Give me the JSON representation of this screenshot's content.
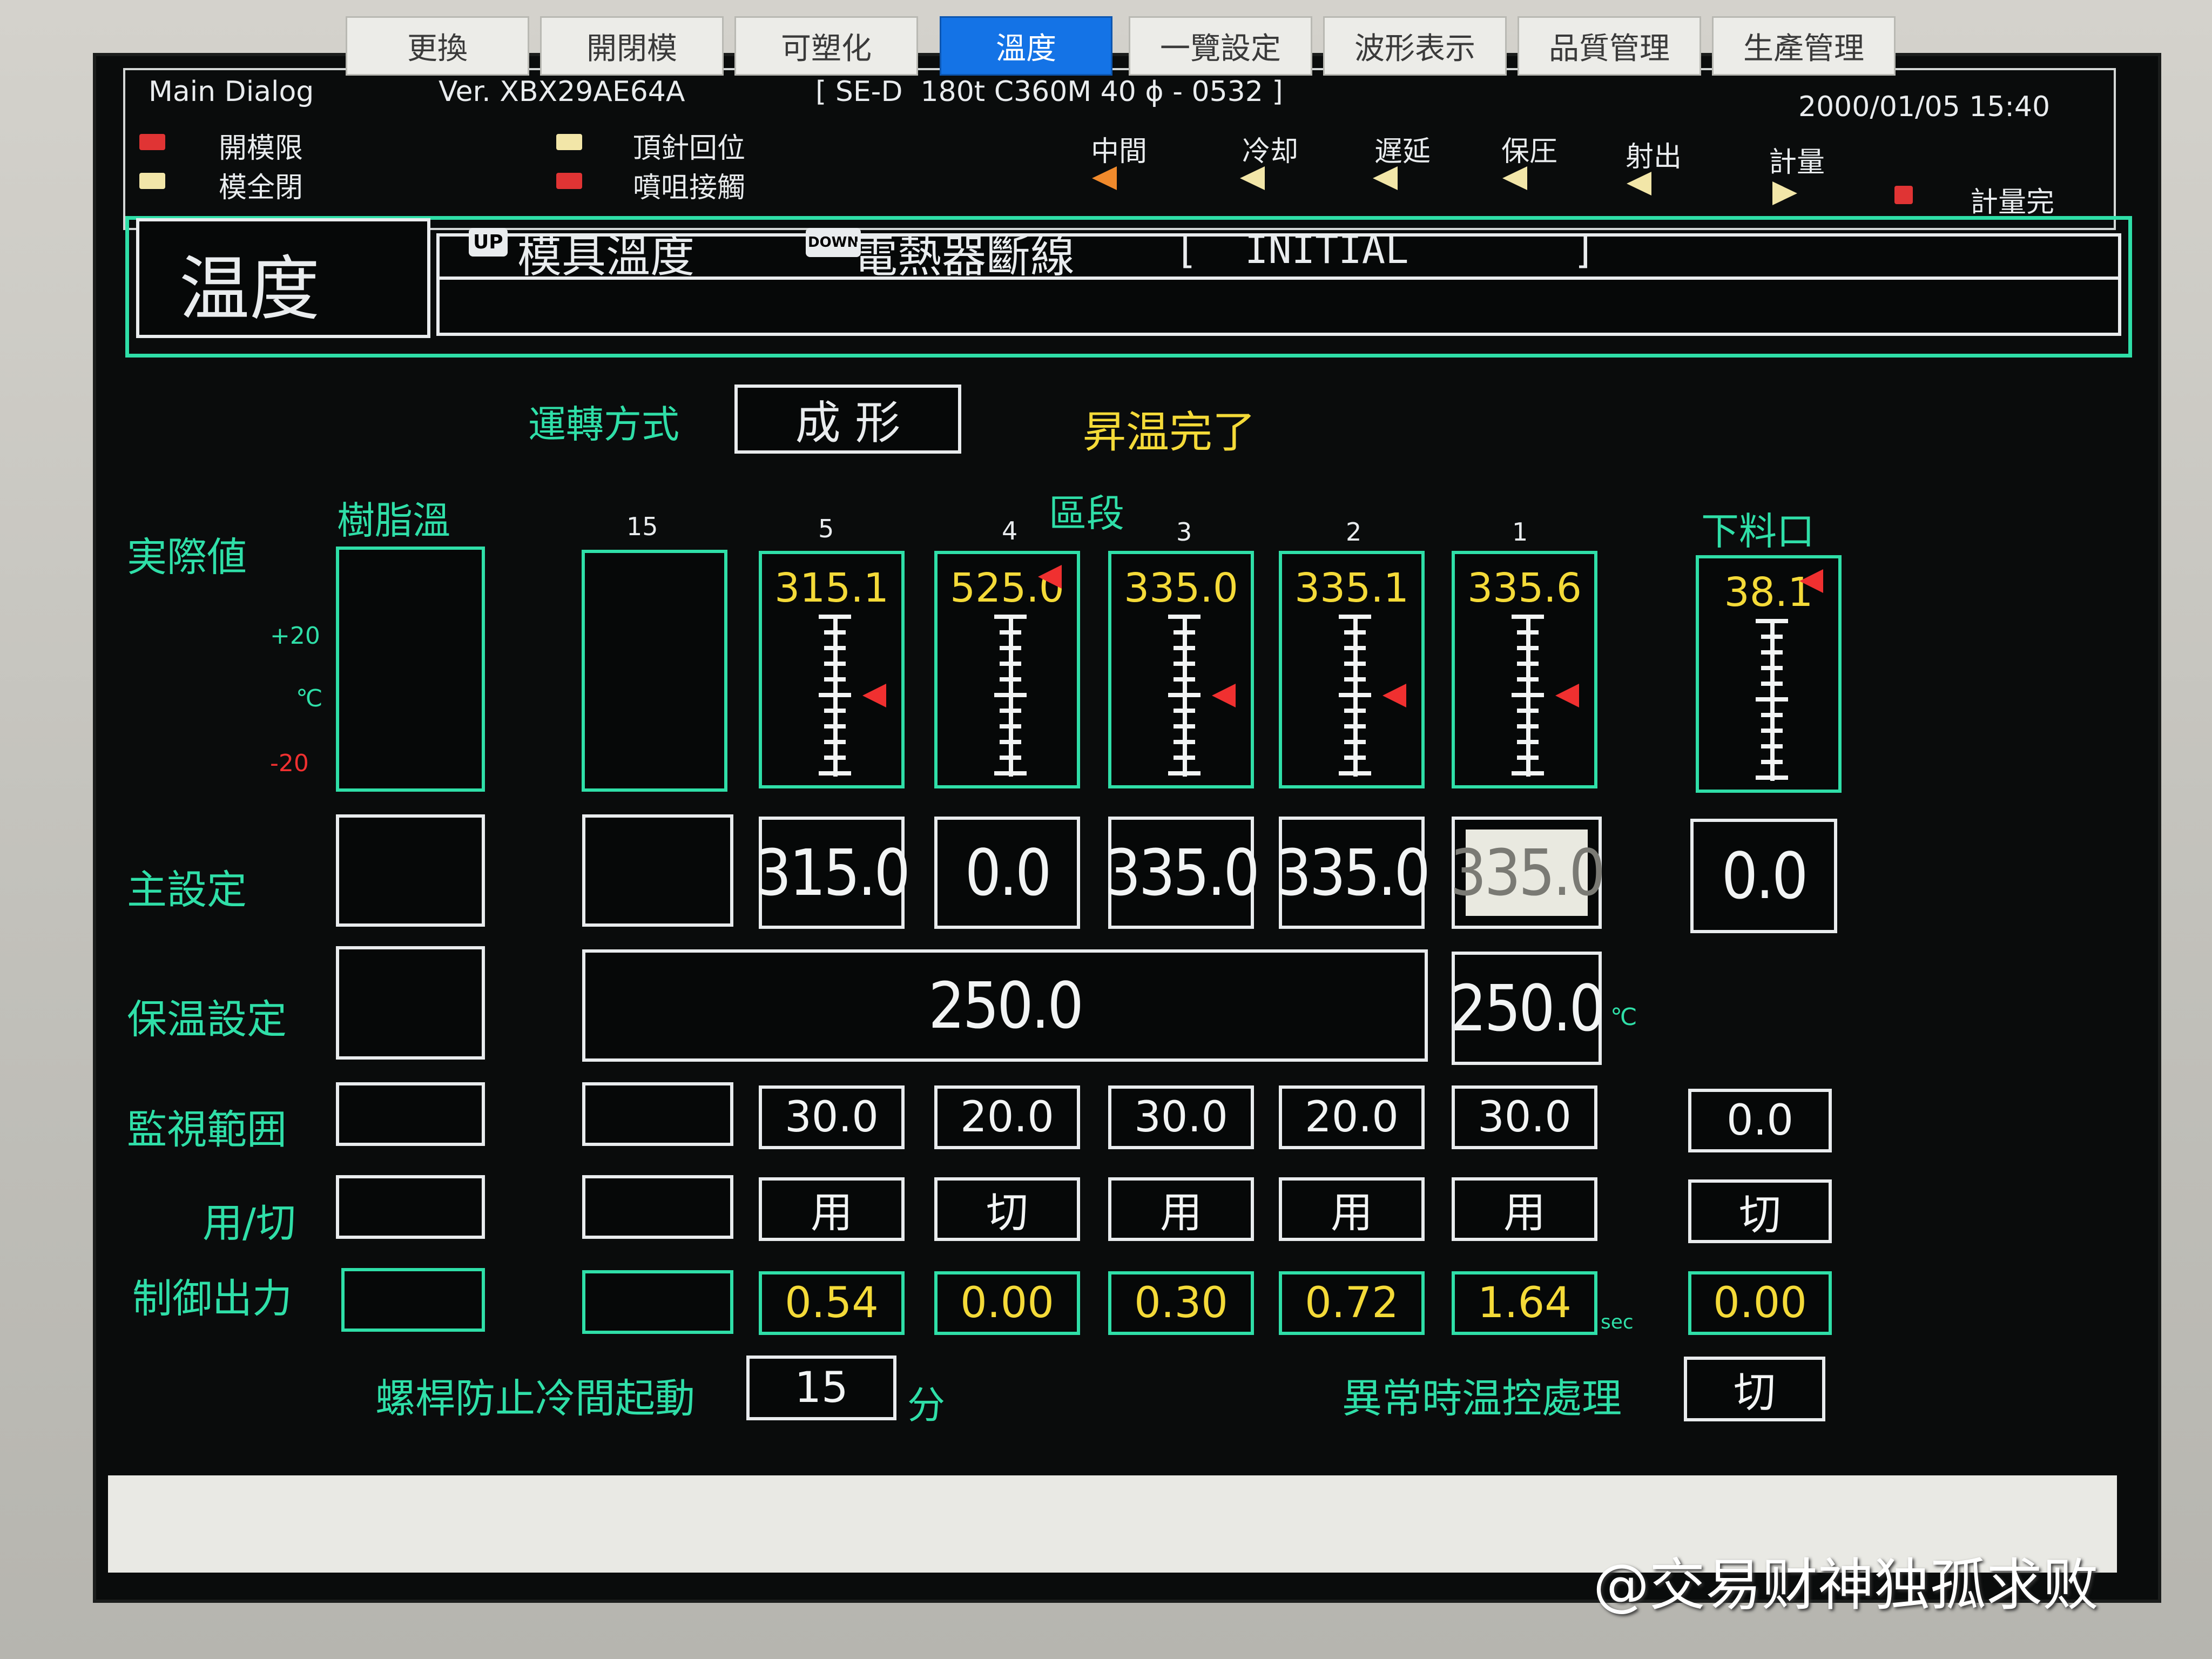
{
  "header": {
    "dialog": "Main Dialog",
    "version": "Ver. XBX29AE64A",
    "machine": "[ SE-D  180t C360M 40 ϕ - 0532 ]",
    "datetime": "2000/01/05 15:40"
  },
  "status_lamps": [
    {
      "label": "開模限",
      "color": "#e03434"
    },
    {
      "label": "模全閉",
      "color": "#f2e6a8"
    },
    {
      "label": "頂針回位",
      "color": "#f2e6a8"
    },
    {
      "label": "噴咀接觸",
      "color": "#e03434"
    }
  ],
  "process_steps": [
    "中間",
    "冷却",
    "遅延",
    "保圧",
    "射出",
    "計量",
    "計量完"
  ],
  "title": {
    "screen_name": "温度",
    "up_key": "UP",
    "up_label": "模具溫度",
    "down_key": "DOWN",
    "down_label": "電熱器斷線",
    "state": "[  INITIAL       ]"
  },
  "mode": {
    "label": "運轉方式",
    "value": "成 形",
    "status": "昇温完了"
  },
  "zone_header": "區段",
  "row_labels": {
    "actual": "実際値",
    "main_set": "主設定",
    "hold_set": "保温設定",
    "monitor": "監視範囲",
    "use": "用/切",
    "output": "制御出力"
  },
  "resin_column": {
    "label": "樹脂溫",
    "plus": "+20",
    "unit": "℃",
    "minus": "-20"
  },
  "feed_column_label": "下料口",
  "zones": [
    {
      "id": "15",
      "actual": "",
      "main_set": "",
      "monitor": "",
      "use": "",
      "output": "",
      "marker_level": null
    },
    {
      "id": "5",
      "actual": "315.1",
      "main_set": "315.0",
      "monitor": "30.0",
      "use": "用",
      "output": "0.54",
      "marker_level": 0.5
    },
    {
      "id": "4",
      "actual": "525.0",
      "main_set": "0.0",
      "monitor": "20.0",
      "use": "切",
      "output": "0.00",
      "marker_level": 1.0
    },
    {
      "id": "3",
      "actual": "335.0",
      "main_set": "335.0",
      "monitor": "30.0",
      "use": "用",
      "output": "0.30",
      "marker_level": 0.5
    },
    {
      "id": "2",
      "actual": "335.1",
      "main_set": "335.0",
      "monitor": "20.0",
      "use": "用",
      "output": "0.72",
      "marker_level": 0.5
    },
    {
      "id": "1",
      "actual": "335.6",
      "main_set": "335.0",
      "monitor": "30.0",
      "use": "用",
      "output": "1.64",
      "marker_level": 0.5
    }
  ],
  "feed": {
    "actual": "38.1",
    "main_set": "0.0",
    "monitor": "0.0",
    "use": "切",
    "output": "0.00",
    "marker_level": 1.0
  },
  "hold_set": {
    "zones": "250.0",
    "zone1": "250.0",
    "unit": "℃"
  },
  "output_unit": "sec",
  "cold_start": {
    "label": "螺桿防止冷間起動",
    "value": "15",
    "unit": "分"
  },
  "abnormal": {
    "label": "異常時温控處理",
    "value": "切"
  },
  "tabs": [
    {
      "label": "更換",
      "active": false
    },
    {
      "label": "開閉模",
      "active": false
    },
    {
      "label": "可塑化",
      "active": false
    },
    {
      "label": "溫度",
      "active": true
    },
    {
      "label": "一覽設定",
      "active": false
    },
    {
      "label": "波形表示",
      "active": false
    },
    {
      "label": "品質管理",
      "active": false
    },
    {
      "label": "生產管理",
      "active": false
    }
  ],
  "watermark": "@交易财神独孤求败"
}
